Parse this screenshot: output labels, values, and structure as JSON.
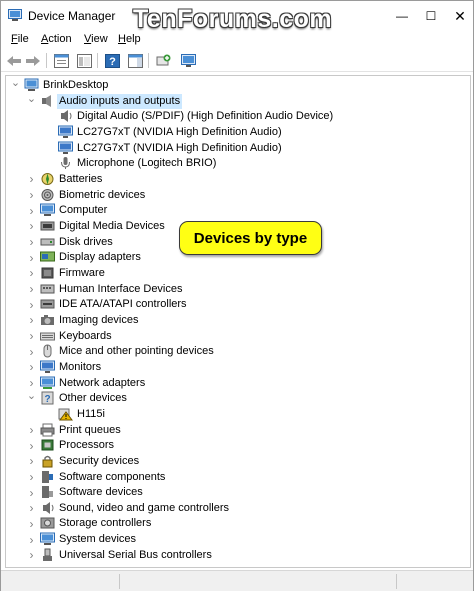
{
  "window": {
    "title": "Device Manager",
    "watermark": "TenForums.com",
    "minimize_glyph": "—",
    "maximize_glyph": "☐",
    "close_glyph": "✕"
  },
  "menu": [
    {
      "label": "File",
      "underline": "F",
      "rest": "ile"
    },
    {
      "label": "Action",
      "underline": "A",
      "rest": "ction"
    },
    {
      "label": "View",
      "underline": "V",
      "rest": "iew"
    },
    {
      "label": "Help",
      "underline": "H",
      "rest": "elp"
    }
  ],
  "toolbar": [
    {
      "name": "back-arrow-icon",
      "glyph": "⇦"
    },
    {
      "name": "forward-arrow-icon",
      "glyph": "⇨"
    },
    {
      "name": "properties-icon",
      "glyph": "▤"
    },
    {
      "name": "show-hide-tree-icon",
      "glyph": "▦"
    },
    {
      "name": "help-icon",
      "glyph": "?"
    },
    {
      "name": "action-pane-icon",
      "glyph": "▥"
    },
    {
      "name": "scan-hardware-icon",
      "glyph": "⌖"
    },
    {
      "name": "monitor-icon",
      "glyph": "▭"
    }
  ],
  "tree": {
    "root": "BrinkDesktop",
    "categories": [
      {
        "label": "Audio inputs and outputs",
        "expanded": true,
        "selected": true,
        "icon": "speaker-icon",
        "children": [
          {
            "label": "Digital Audio (S/PDIF) (High Definition Audio Device)",
            "icon": "audio-device-icon"
          },
          {
            "label": "LC27G7xT (NVIDIA High Definition Audio)",
            "icon": "monitor-icon"
          },
          {
            "label": "LC27G7xT (NVIDIA High Definition Audio)",
            "icon": "monitor-icon"
          },
          {
            "label": "Microphone (Logitech BRIO)",
            "icon": "microphone-icon"
          }
        ]
      },
      {
        "label": "Batteries",
        "icon": "battery-icon"
      },
      {
        "label": "Biometric devices",
        "icon": "fingerprint-icon"
      },
      {
        "label": "Computer",
        "icon": "computer-icon"
      },
      {
        "label": "Digital Media Devices",
        "icon": "media-device-icon"
      },
      {
        "label": "Disk drives",
        "icon": "disk-drive-icon"
      },
      {
        "label": "Display adapters",
        "icon": "display-adapter-icon"
      },
      {
        "label": "Firmware",
        "icon": "firmware-icon"
      },
      {
        "label": "Human Interface Devices",
        "icon": "hid-icon"
      },
      {
        "label": "IDE ATA/ATAPI controllers",
        "icon": "ide-controller-icon"
      },
      {
        "label": "Imaging devices",
        "icon": "camera-icon"
      },
      {
        "label": "Keyboards",
        "icon": "keyboard-icon"
      },
      {
        "label": "Mice and other pointing devices",
        "icon": "mouse-icon"
      },
      {
        "label": "Monitors",
        "icon": "monitor-icon"
      },
      {
        "label": "Network adapters",
        "icon": "network-adapter-icon"
      },
      {
        "label": "Other devices",
        "expanded": true,
        "icon": "other-devices-icon",
        "children": [
          {
            "label": "H115i",
            "icon": "warning-device-icon"
          }
        ]
      },
      {
        "label": "Print queues",
        "icon": "printer-icon"
      },
      {
        "label": "Processors",
        "icon": "processor-icon"
      },
      {
        "label": "Security devices",
        "icon": "security-device-icon"
      },
      {
        "label": "Software components",
        "icon": "software-component-icon"
      },
      {
        "label": "Software devices",
        "icon": "software-device-icon"
      },
      {
        "label": "Sound, video and game controllers",
        "icon": "sound-controller-icon"
      },
      {
        "label": "Storage controllers",
        "icon": "storage-controller-icon"
      },
      {
        "label": "System devices",
        "icon": "system-device-icon"
      },
      {
        "label": "Universal Serial Bus controllers",
        "icon": "usb-icon"
      }
    ]
  },
  "callout": {
    "text": "Devices by type"
  },
  "colors": {
    "selection": "#cce8ff",
    "callout_fill": "#ffff14",
    "icon_blue": "#2b6cb5",
    "icon_monitor": "#3c78c8",
    "icon_yellow": "#e8b600"
  }
}
